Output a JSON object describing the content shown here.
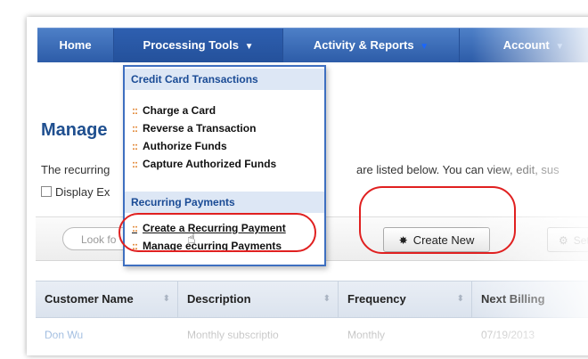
{
  "nav": {
    "items": [
      {
        "label": "Home"
      },
      {
        "label": "Processing Tools"
      },
      {
        "label": "Activity & Reports"
      },
      {
        "label": "Account"
      }
    ]
  },
  "dropdown": {
    "section1": {
      "header": "Credit Card Transactions",
      "items": [
        "Charge a Card",
        "Reverse a Transaction",
        "Authorize Funds",
        "Capture Authorized Funds"
      ]
    },
    "section2": {
      "header": "Recurring Payments",
      "items": [
        "Create a Recurring Payment",
        "Manage  ecurring Payments"
      ]
    }
  },
  "page": {
    "title": "Manage",
    "desc_left": "The recurring",
    "desc_right": "are listed below. You can view, edit, sus",
    "checkbox_label": "Display Ex"
  },
  "toolbar": {
    "search_text": "Look fo",
    "create_label": "Create New",
    "settings_label": "Settin"
  },
  "table": {
    "columns": [
      "Customer Name",
      "Description",
      "Frequency",
      "Next Billing"
    ],
    "rows": [
      {
        "customer": "Don Wu",
        "description": "Monthly subscriptio",
        "frequency": "Monthly",
        "next_billing": "07/19/2013"
      }
    ]
  },
  "colors": {
    "nav": "#2d5ca8",
    "accent_orange": "#e0802a",
    "highlight_red": "#e02020",
    "dropdown_border": "#3e6fc0"
  }
}
